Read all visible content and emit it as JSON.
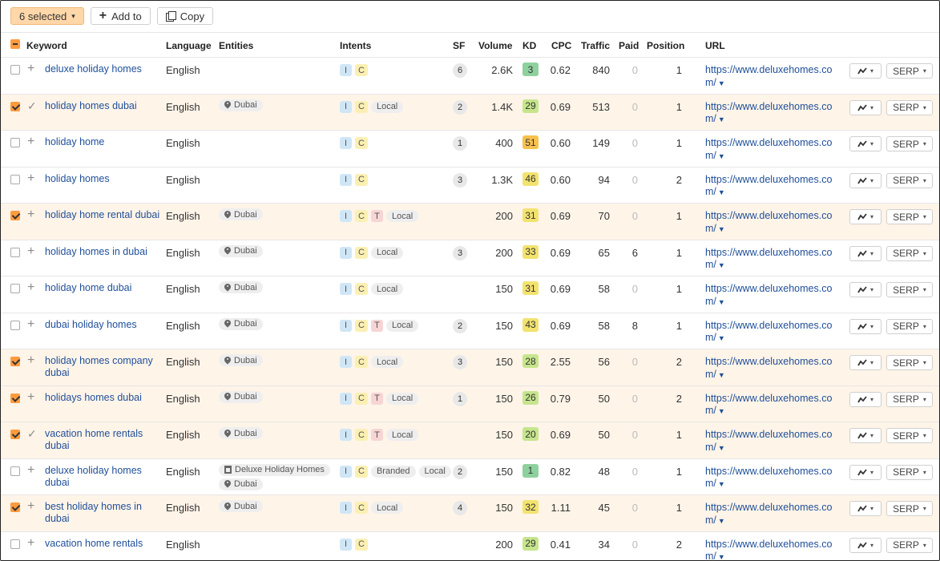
{
  "toolbar": {
    "selected_label": "6 selected",
    "add_label": "Add to",
    "copy_label": "Copy"
  },
  "columns": {
    "keyword": "Keyword",
    "language": "Language",
    "entities": "Entities",
    "intents": "Intents",
    "sf": "SF",
    "volume": "Volume",
    "kd": "KD",
    "cpc": "CPC",
    "traffic": "Traffic",
    "paid": "Paid",
    "position": "Position",
    "url": "URL"
  },
  "serp_label": "SERP",
  "colors": {
    "kd_green_dark": "#8fd19e",
    "kd_green_light": "#c6e58c",
    "kd_yellow": "#f2e36f",
    "kd_orange": "#f6c14d",
    "selected_row": "#fff4e8",
    "accent_orange": "#ff9b3f",
    "link_blue": "#1f4f9a"
  },
  "rows": [
    {
      "keyword": "deluxe holiday homes",
      "language": "English",
      "entities": [],
      "intents": [
        "I",
        "C"
      ],
      "sf": "6",
      "volume": "2.6K",
      "kd": "3",
      "kd_level": "green_dark",
      "cpc": "0.62",
      "traffic": "840",
      "paid": "0",
      "position": "1",
      "url": "https://www.deluxehomes.com/",
      "checked": false,
      "row_icon": "plus"
    },
    {
      "keyword": "holiday homes dubai",
      "language": "English",
      "entities": [
        {
          "type": "location",
          "label": "Dubai"
        }
      ],
      "intents": [
        "I",
        "C",
        "Local"
      ],
      "sf": "2",
      "volume": "1.4K",
      "kd": "29",
      "kd_level": "green_light",
      "cpc": "0.69",
      "traffic": "513",
      "paid": "0",
      "position": "1",
      "url": "https://www.deluxehomes.com/",
      "checked": true,
      "row_icon": "check"
    },
    {
      "keyword": "holiday home",
      "language": "English",
      "entities": [],
      "intents": [
        "I",
        "C"
      ],
      "sf": "1",
      "volume": "400",
      "kd": "51",
      "kd_level": "orange",
      "cpc": "0.60",
      "traffic": "149",
      "paid": "0",
      "position": "1",
      "url": "https://www.deluxehomes.com/",
      "checked": false,
      "row_icon": "plus"
    },
    {
      "keyword": "holiday homes",
      "language": "English",
      "entities": [],
      "intents": [
        "I",
        "C"
      ],
      "sf": "3",
      "volume": "1.3K",
      "kd": "46",
      "kd_level": "yellow",
      "cpc": "0.60",
      "traffic": "94",
      "paid": "0",
      "position": "2",
      "url": "https://www.deluxehomes.com/",
      "checked": false,
      "row_icon": "plus"
    },
    {
      "keyword": "holiday home rental dubai",
      "language": "English",
      "entities": [
        {
          "type": "location",
          "label": "Dubai"
        }
      ],
      "intents": [
        "I",
        "C",
        "T",
        "Local"
      ],
      "sf": "",
      "volume": "200",
      "kd": "31",
      "kd_level": "yellow",
      "cpc": "0.69",
      "traffic": "70",
      "paid": "0",
      "position": "1",
      "url": "https://www.deluxehomes.com/",
      "checked": true,
      "row_icon": "plus"
    },
    {
      "keyword": "holiday homes in dubai",
      "language": "English",
      "entities": [
        {
          "type": "location",
          "label": "Dubai"
        }
      ],
      "intents": [
        "I",
        "C",
        "Local"
      ],
      "sf": "3",
      "volume": "200",
      "kd": "33",
      "kd_level": "yellow",
      "cpc": "0.69",
      "traffic": "65",
      "paid": "6",
      "position": "1",
      "url": "https://www.deluxehomes.com/",
      "checked": false,
      "row_icon": "plus"
    },
    {
      "keyword": "holiday home dubai",
      "language": "English",
      "entities": [
        {
          "type": "location",
          "label": "Dubai"
        }
      ],
      "intents": [
        "I",
        "C",
        "Local"
      ],
      "sf": "",
      "volume": "150",
      "kd": "31",
      "kd_level": "yellow",
      "cpc": "0.69",
      "traffic": "58",
      "paid": "0",
      "position": "1",
      "url": "https://www.deluxehomes.com/",
      "checked": false,
      "row_icon": "plus"
    },
    {
      "keyword": "dubai holiday homes",
      "language": "English",
      "entities": [
        {
          "type": "location",
          "label": "Dubai"
        }
      ],
      "intents": [
        "I",
        "C",
        "T",
        "Local"
      ],
      "sf": "2",
      "volume": "150",
      "kd": "43",
      "kd_level": "yellow",
      "cpc": "0.69",
      "traffic": "58",
      "paid": "8",
      "position": "1",
      "url": "https://www.deluxehomes.com/",
      "checked": false,
      "row_icon": "plus"
    },
    {
      "keyword": "holiday homes company dubai",
      "language": "English",
      "entities": [
        {
          "type": "location",
          "label": "Dubai"
        }
      ],
      "intents": [
        "I",
        "C",
        "Local"
      ],
      "sf": "3",
      "volume": "150",
      "kd": "28",
      "kd_level": "green_light",
      "cpc": "2.55",
      "traffic": "56",
      "paid": "0",
      "position": "2",
      "url": "https://www.deluxehomes.com/",
      "checked": true,
      "row_icon": "plus"
    },
    {
      "keyword": "holidays homes dubai",
      "language": "English",
      "entities": [
        {
          "type": "location",
          "label": "Dubai"
        }
      ],
      "intents": [
        "I",
        "C",
        "T",
        "Local"
      ],
      "sf": "1",
      "volume": "150",
      "kd": "26",
      "kd_level": "green_light",
      "cpc": "0.79",
      "traffic": "50",
      "paid": "0",
      "position": "2",
      "url": "https://www.deluxehomes.com/",
      "checked": true,
      "row_icon": "plus"
    },
    {
      "keyword": "vacation home rentals dubai",
      "language": "English",
      "entities": [
        {
          "type": "location",
          "label": "Dubai"
        }
      ],
      "intents": [
        "I",
        "C",
        "T",
        "Local"
      ],
      "sf": "",
      "volume": "150",
      "kd": "20",
      "kd_level": "green_light",
      "cpc": "0.69",
      "traffic": "50",
      "paid": "0",
      "position": "1",
      "url": "https://www.deluxehomes.com/",
      "checked": true,
      "row_icon": "check"
    },
    {
      "keyword": "deluxe holiday homes dubai",
      "language": "English",
      "entities": [
        {
          "type": "business",
          "label": "Deluxe Holiday Homes"
        },
        {
          "type": "location",
          "label": "Dubai"
        }
      ],
      "intents": [
        "I",
        "C",
        "Branded",
        "Local"
      ],
      "sf": "2",
      "volume": "150",
      "kd": "1",
      "kd_level": "green_dark",
      "cpc": "0.82",
      "traffic": "48",
      "paid": "0",
      "position": "1",
      "url": "https://www.deluxehomes.com/",
      "checked": false,
      "row_icon": "plus"
    },
    {
      "keyword": "best holiday homes in dubai",
      "language": "English",
      "entities": [
        {
          "type": "location",
          "label": "Dubai"
        }
      ],
      "intents": [
        "I",
        "C",
        "Local"
      ],
      "sf": "4",
      "volume": "150",
      "kd": "32",
      "kd_level": "yellow",
      "cpc": "1.11",
      "traffic": "45",
      "paid": "0",
      "position": "1",
      "url": "https://www.deluxehomes.com/",
      "checked": true,
      "row_icon": "plus"
    },
    {
      "keyword": "vacation home rentals",
      "language": "English",
      "entities": [],
      "intents": [
        "I",
        "C"
      ],
      "sf": "",
      "volume": "200",
      "kd": "29",
      "kd_level": "green_light",
      "cpc": "0.41",
      "traffic": "34",
      "paid": "0",
      "position": "2",
      "url": "https://www.deluxehomes.com/",
      "checked": false,
      "row_icon": "plus"
    }
  ]
}
